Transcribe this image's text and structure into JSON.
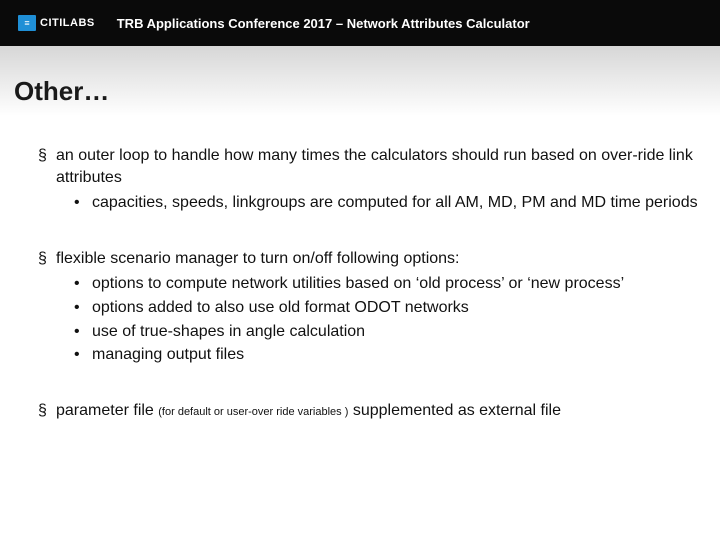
{
  "header": {
    "logo_mark": "≡",
    "logo_text": "CITILABS",
    "title": "TRB Applications Conference 2017 – Network Attributes Calculator"
  },
  "slide": {
    "title": "Other…",
    "bullets": [
      {
        "text": "an outer loop to handle how many times the calculators should run based on over-ride link attributes",
        "sub": [
          "capacities, speeds, linkgroups are computed for all AM, MD, PM and MD time periods"
        ]
      },
      {
        "text": "flexible scenario manager to turn on/off following options:",
        "sub": [
          "options to compute network utilities based on ‘old process’ or ‘new process’",
          "options added to also use old format ODOT networks",
          "use of true-shapes in angle calculation",
          "managing output files"
        ]
      },
      {
        "text_pre": "parameter file ",
        "paren": "(for default or user-over ride variables )",
        "text_post": " supplemented as external file",
        "sub": []
      }
    ]
  }
}
